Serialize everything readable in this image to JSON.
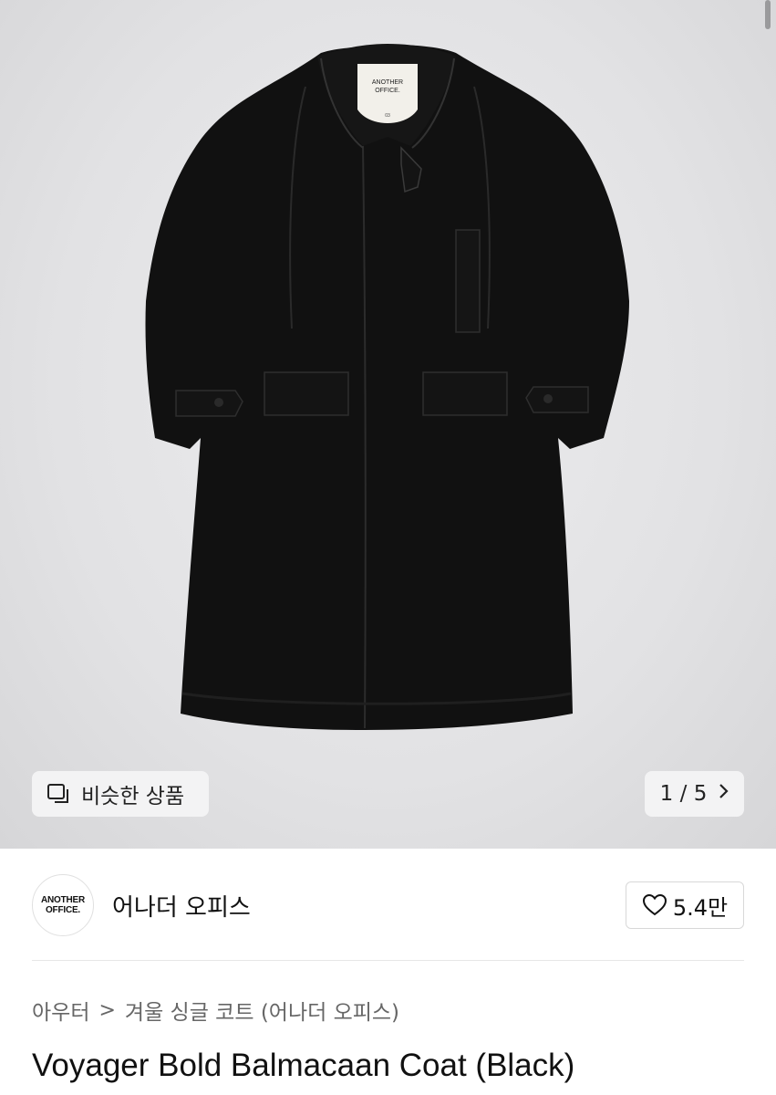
{
  "hero": {
    "image_label": "black wool balmacaan coat",
    "tag_line1": "ANOTHER",
    "tag_line2": "OFFICE.",
    "tag_size": "03"
  },
  "similar_button": {
    "label": "비슷한 상품",
    "icon": "similar-items-icon"
  },
  "pager": {
    "current": "1",
    "separator": "/",
    "total": "5",
    "icon": "chevron-right-icon"
  },
  "brand": {
    "logo_line1": "ANOTHER",
    "logo_line2": "OFFICE.",
    "name": "어나더 오피스",
    "likes": "5.4만",
    "like_icon": "heart-outline-icon"
  },
  "breadcrumb": {
    "category": "아우터",
    "separator": ">",
    "subcategory": "겨울 싱글 코트 (어나더 오피스)"
  },
  "product": {
    "title": "Voyager Bold Balmacaan Coat (Black)"
  },
  "colors": {
    "coat": "#111111",
    "background": "#e3e3e5"
  }
}
